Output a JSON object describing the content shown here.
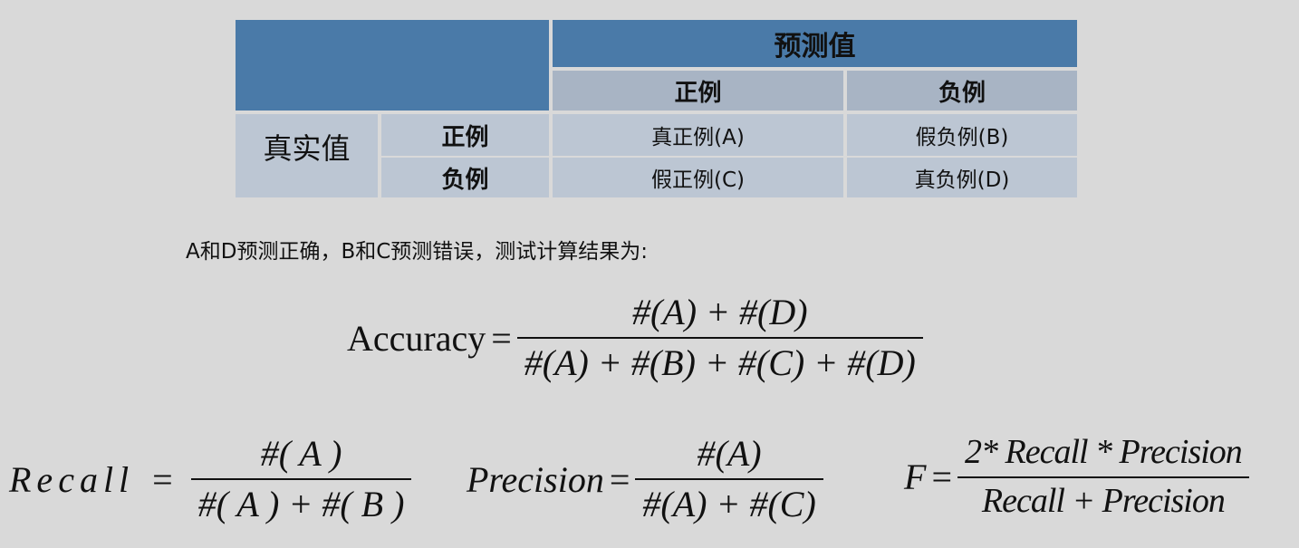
{
  "table": {
    "predicted_header": "预测值",
    "pred_pos": "正例",
    "pred_neg": "负例",
    "actual_label": "真实值",
    "actual_pos": "正例",
    "actual_neg": "负例",
    "tp": "真正例(A)",
    "fn": "假负例(B)",
    "fp": "假正例(C)",
    "tn": "真负例(D)"
  },
  "description": "A和D预测正确，B和C预测错误，测试计算结果为:",
  "formulas": {
    "accuracy": {
      "lhs": "Accuracy",
      "eq": "=",
      "numerator": "#(A) + #(D)",
      "denominator": "#(A) + #(B) + #(C) + #(D)"
    },
    "recall": {
      "lhs": "Recall",
      "eq": "=",
      "numerator": "#( A )",
      "denominator": "#( A ) + #( B )"
    },
    "precision": {
      "lhs": "Precision",
      "eq": "=",
      "numerator": "#(A)",
      "denominator": "#(A) + #(C)"
    },
    "f": {
      "lhs": "F",
      "eq": "=",
      "numerator": "2* Recall * Precision",
      "denominator": "Recall + Precision"
    }
  },
  "colors": {
    "header_dark": "#4a7aa8",
    "header_mid": "#a8b4c4",
    "cell_light": "#bcc6d3",
    "background": "#d9d9d9"
  }
}
